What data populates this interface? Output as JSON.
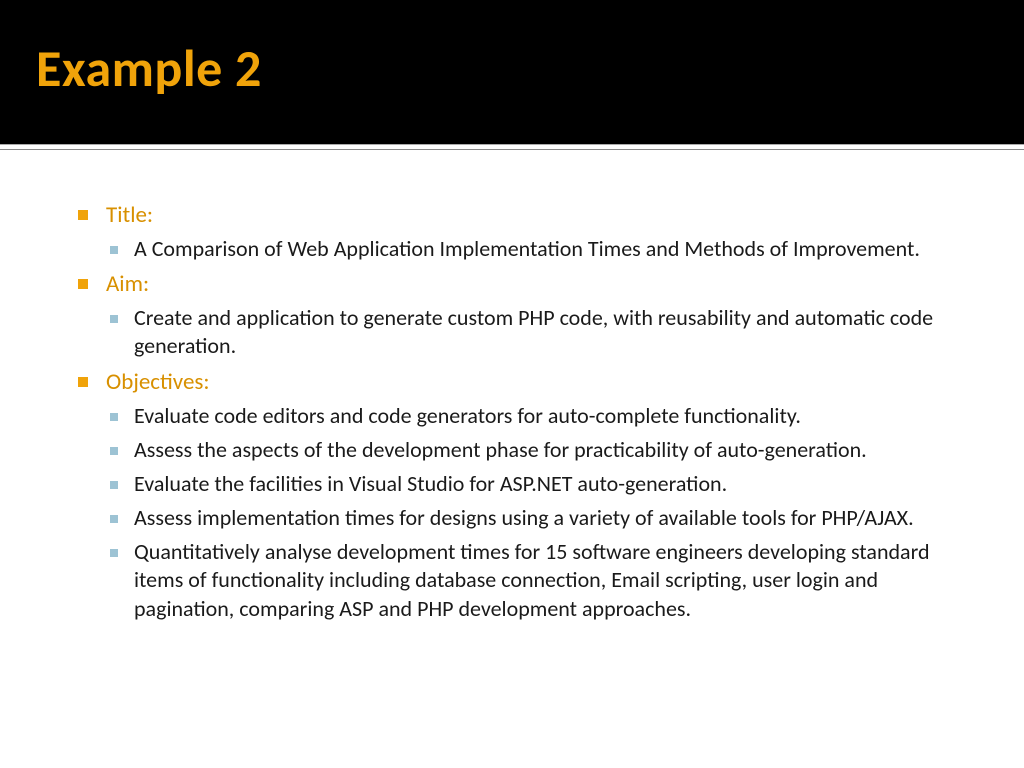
{
  "slide": {
    "title": "Example 2",
    "sections": [
      {
        "label": "Title:",
        "items": [
          "A Comparison of Web Application Implementation Times and Methods of Improvement."
        ]
      },
      {
        "label": "Aim:",
        "items": [
          "Create and application to generate custom PHP code, with reusability and automatic code generation."
        ]
      },
      {
        "label": "Objectives:",
        "items": [
          "Evaluate code editors and code generators for auto-complete functionality.",
          "Assess the aspects of the development phase for practicability of auto-generation.",
          "Evaluate the facilities in Visual Studio for ASP.NET auto-generation.",
          "Assess implementation times for designs using a variety of available tools for PHP/AJAX.",
          "Quantitatively analyse development times for 15 software engineers developing standard items of functionality including database connection, Email scripting, user login and pagination, comparing ASP and PHP development approaches."
        ]
      }
    ]
  }
}
